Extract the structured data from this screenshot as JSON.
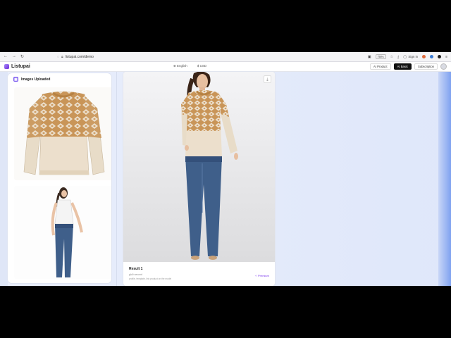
{
  "browser": {
    "url": "listupai.com/demo",
    "zoom": "75%",
    "sign_in": "Sign in"
  },
  "app": {
    "logo_text": "Listupai",
    "language": "English",
    "currency": "USD",
    "actions": [
      "AI Product",
      "AI Basic",
      "Subscription"
    ]
  },
  "left_panel": {
    "title": "Images Uploaded"
  },
  "result": {
    "title": "Result 1",
    "subtitle": "glu0 second",
    "note": "profile, template, link product on the model",
    "link": "Premium"
  },
  "colors": {
    "accent": "#7c5cf0",
    "sweater_tan": "#c99558",
    "sweater_cream": "#ecdfcc",
    "jeans": "#3f5f8a"
  }
}
